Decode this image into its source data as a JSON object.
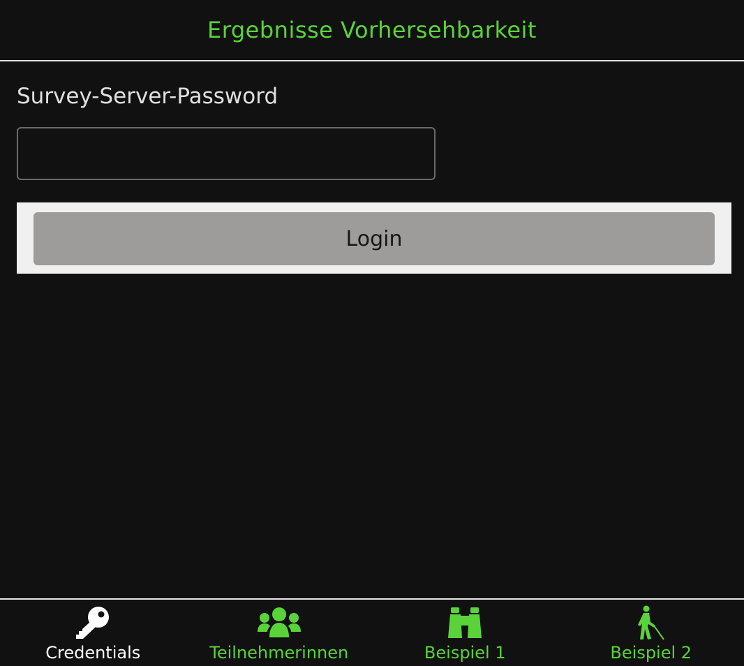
{
  "header": {
    "title": "Ergebnisse Vorhersehbarkeit"
  },
  "form": {
    "password_label": "Survey-Server-Password",
    "password_value": "",
    "password_placeholder": "",
    "login_label": "Login"
  },
  "tabbar": {
    "tabs": [
      {
        "label": "Credentials",
        "icon": "key-icon",
        "active": true
      },
      {
        "label": "Teilnehmerinnen",
        "icon": "users-icon",
        "active": false
      },
      {
        "label": "Beispiel 1",
        "icon": "binoculars-icon",
        "active": false
      },
      {
        "label": "Beispiel 2",
        "icon": "blind-person-icon",
        "active": false
      }
    ]
  },
  "colors": {
    "accent": "#5ad33a",
    "background": "#111111",
    "active_tab": "#ffffff",
    "button": "#9e9c9a",
    "panel": "#f0f0f0"
  }
}
